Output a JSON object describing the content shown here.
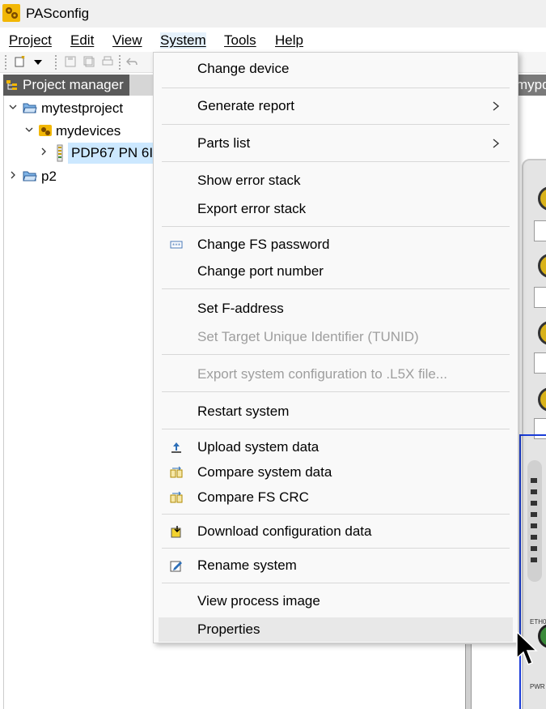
{
  "window": {
    "title": "PASconfig"
  },
  "menubar": [
    {
      "label": "Project"
    },
    {
      "label": "Edit"
    },
    {
      "label": "View"
    },
    {
      "label": "System"
    },
    {
      "label": "Tools"
    },
    {
      "label": "Help"
    }
  ],
  "project_manager": {
    "tab_label": "Project manager",
    "tree": [
      {
        "label": "mytestproject"
      },
      {
        "label": "mydevices"
      },
      {
        "label": "PDP67 PN 6I"
      },
      {
        "label": "p2"
      }
    ]
  },
  "right_tab_label": "mypd",
  "device": {
    "eth_label": "ETH0",
    "pwr_label": "PWR"
  },
  "system_menu": {
    "items": [
      {
        "label": "Change device"
      },
      {
        "label": "Generate report"
      },
      {
        "label": "Parts list"
      },
      {
        "label": "Show error stack"
      },
      {
        "label": "Export error stack"
      },
      {
        "label": "Change FS password"
      },
      {
        "label": "Change port number"
      },
      {
        "label": "Set F-address"
      },
      {
        "label": "Set Target Unique Identifier (TUNID)"
      },
      {
        "label": "Export system configuration to .L5X file..."
      },
      {
        "label": "Restart system"
      },
      {
        "label": "Upload system data"
      },
      {
        "label": "Compare system data"
      },
      {
        "label": "Compare FS CRC"
      },
      {
        "label": "Download configuration data"
      },
      {
        "label": "Rename system"
      },
      {
        "label": "View process image"
      },
      {
        "label": "Properties"
      }
    ]
  }
}
